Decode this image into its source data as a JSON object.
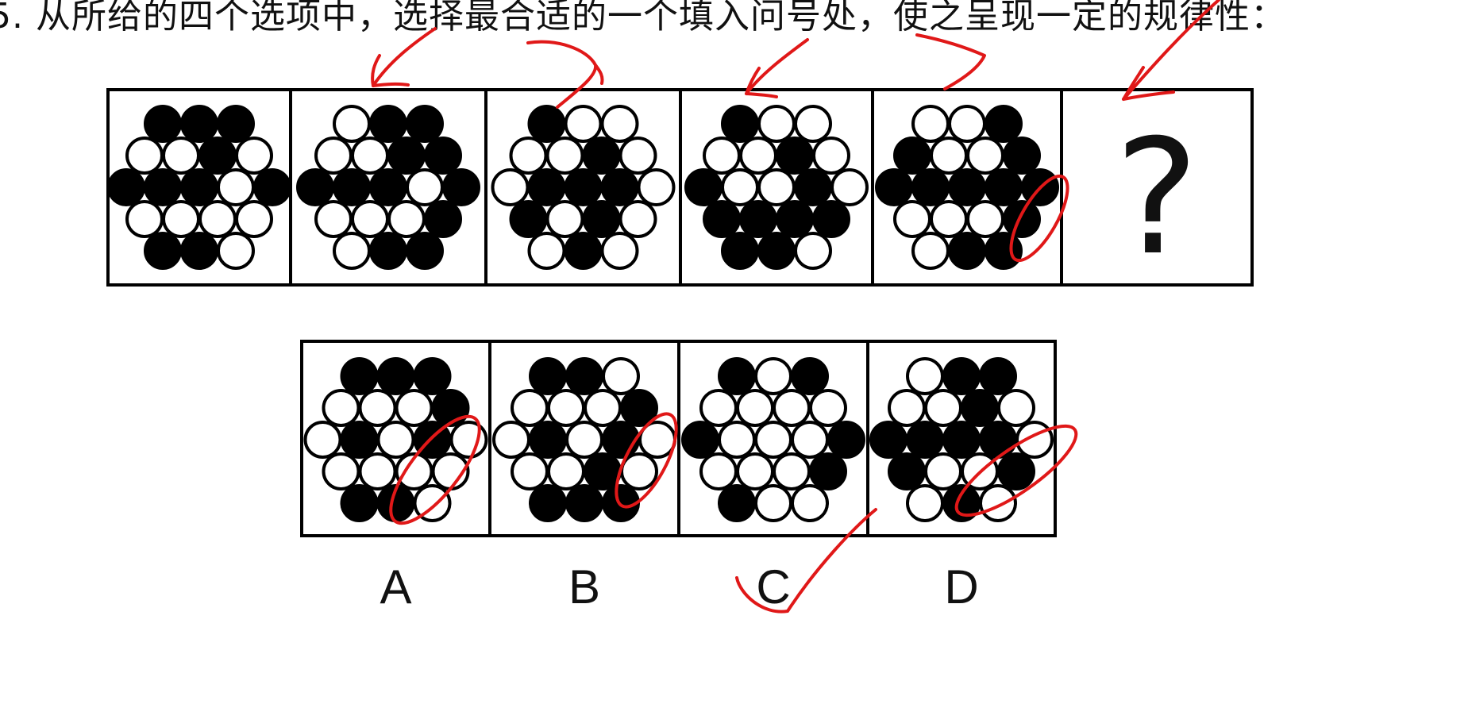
{
  "question": {
    "text": "5. 从所给的四个选项中，选择最合适的一个填入问号处，使之呈现一定的规律性："
  },
  "sequence": {
    "figures": [
      {
        "pattern": "1110010111010000110101100"
      },
      {
        "pattern": "0110011111010001011011100"
      },
      {
        "pattern": "1000010011101010010111010"
      },
      {
        "pattern": "1000010100101111110111000"
      },
      {
        "pattern": "0011001111110001011010110"
      },
      {
        "question_mark": "?"
      }
    ]
  },
  "options": [
    {
      "label": "A",
      "pattern": "1110001010100000110101001"
    },
    {
      "label": "B",
      "pattern": "1100001010100010111011110"
    },
    {
      "label": "C",
      "pattern": "1010000100010001100010011"
    },
    {
      "label": "D",
      "pattern": "0110010111101001010001011"
    }
  ],
  "annotations": {
    "ink_color": "#e01818",
    "marks": [
      "arrow",
      "arrow",
      "arrow",
      "arrow",
      "arrow",
      "ellipse",
      "ellipse",
      "ellipse",
      "ellipse",
      "check"
    ]
  }
}
